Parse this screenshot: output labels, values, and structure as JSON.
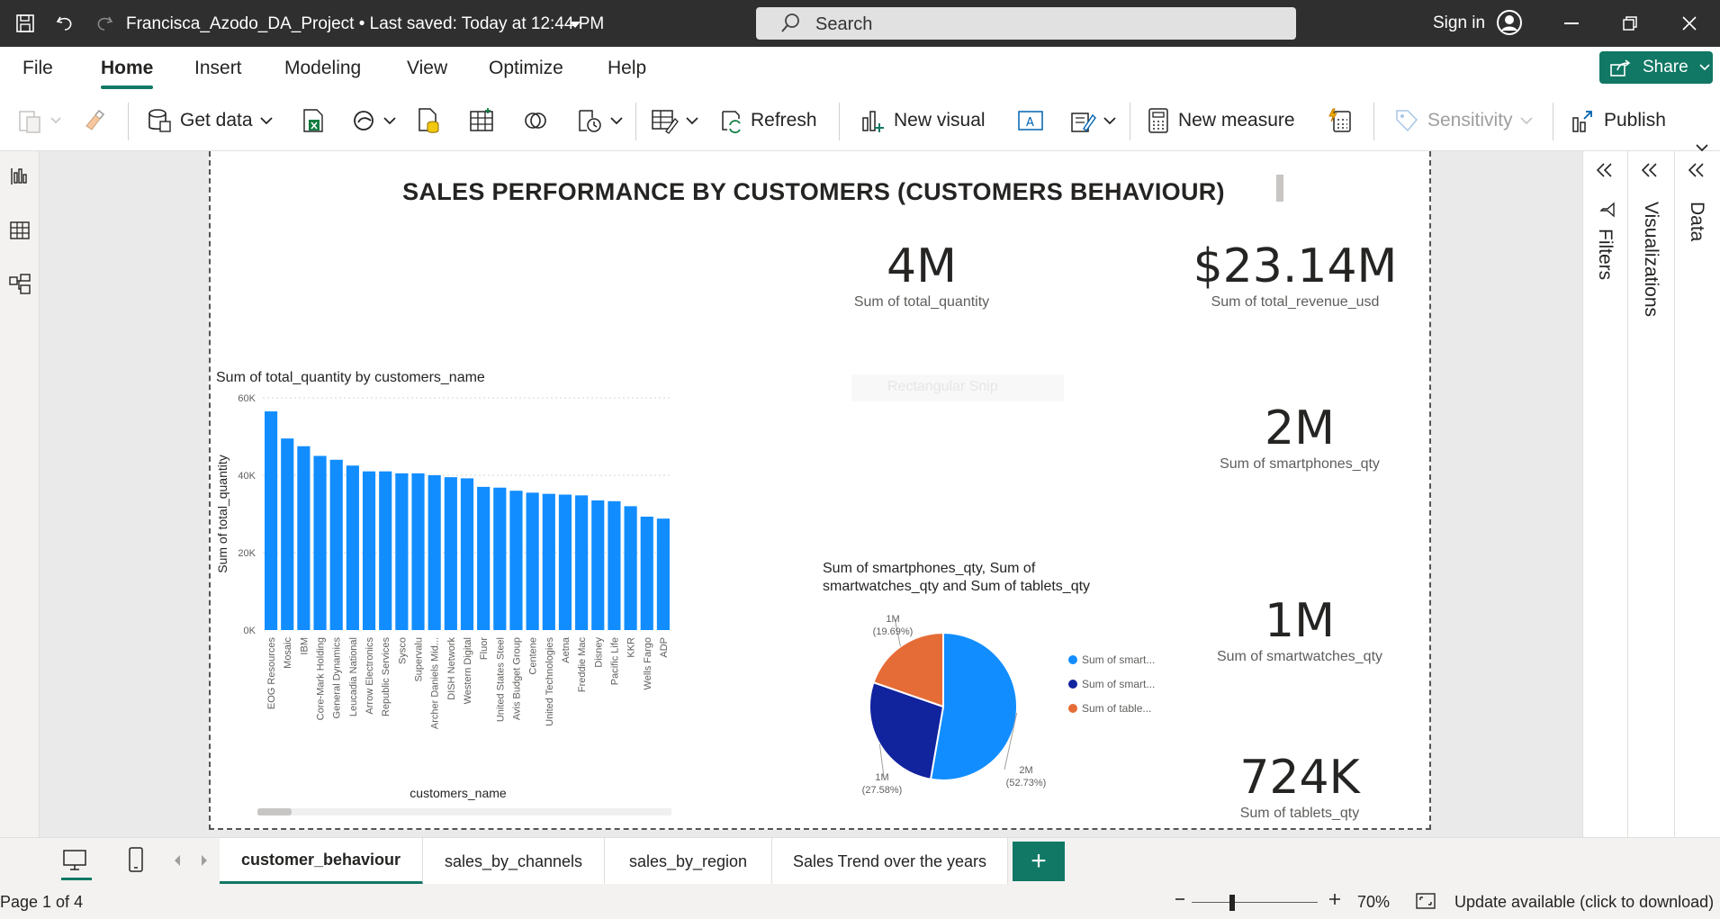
{
  "window": {
    "title": "Francisca_Azodo_DA_Project",
    "saved": " • Last saved: Today at 12:44 PM",
    "search_placeholder": "Search",
    "sign_in": "Sign in"
  },
  "menu": {
    "tabs": [
      "File",
      "Home",
      "Insert",
      "Modeling",
      "View",
      "Optimize",
      "Help"
    ],
    "share": "Share"
  },
  "ribbon": {
    "get_data": "Get data",
    "refresh": "Refresh",
    "new_visual": "New visual",
    "new_measure": "New measure",
    "sensitivity": "Sensitivity",
    "publish": "Publish"
  },
  "report": {
    "title": "SALES PERFORMANCE BY CUSTOMERS (CUSTOMERS BEHAVIOUR)",
    "kpis": [
      {
        "value": "4M",
        "label": "Sum of total_quantity"
      },
      {
        "value": "$23.14M",
        "label": "Sum of total_revenue_usd"
      },
      {
        "value": "2M",
        "label": "Sum of smartphones_qty"
      },
      {
        "value": "1M",
        "label": "Sum of smartwatches_qty"
      },
      {
        "value": "724K",
        "label": "Sum of tablets_qty"
      }
    ],
    "ghost_text": "Rectangular Snip"
  },
  "chart_data": [
    {
      "type": "bar",
      "title": "Sum of total_quantity by customers_name",
      "xlabel": "customers_name",
      "ylabel": "Sum of total_quantity",
      "ylim": [
        0,
        60000
      ],
      "yticks": [
        "0K",
        "20K",
        "40K",
        "60K"
      ],
      "grid": true,
      "color": "#118DFF",
      "categories": [
        "EOG Resources",
        "Mosaic",
        "IBM",
        "Core-Mark Holding",
        "General Dynamics",
        "Leucadia National",
        "Arrow Electronics",
        "Republic Services",
        "Sysco",
        "Supervalu",
        "Archer Daniels Mid...",
        "DISH Network",
        "Western Digital",
        "Fluor",
        "United States Steel",
        "Avis Budget Group",
        "Centene",
        "United Technologies",
        "Aetna",
        "Freddie Mac",
        "Disney",
        "Pacific Life",
        "KKR",
        "Wells Fargo",
        "ADP"
      ],
      "values": [
        56500,
        49500,
        47500,
        45000,
        44000,
        42500,
        41000,
        41000,
        40500,
        40500,
        40000,
        39500,
        39200,
        37000,
        36800,
        36000,
        35500,
        35200,
        35000,
        34800,
        33500,
        33300,
        32000,
        29300,
        28800
      ]
    },
    {
      "type": "pie",
      "title": "Sum of smartphones_qty, Sum of smartwatches_qty and Sum of tablets_qty",
      "legend": "right",
      "series": [
        {
          "name": "Sum of smart...",
          "value": 52.73,
          "label": "2M",
          "pct": "(52.73%)",
          "color": "#118DFF"
        },
        {
          "name": "Sum of smart...",
          "value": 27.58,
          "label": "1M",
          "pct": "(27.58%)",
          "color": "#12239E"
        },
        {
          "name": "Sum of table...",
          "value": 19.69,
          "label": "1M",
          "pct": "(19.69%)",
          "color": "#E66C37"
        }
      ]
    }
  ],
  "panes": {
    "filters": "Filters",
    "visualizations": "Visualizations",
    "data": "Data"
  },
  "pages": {
    "tabs": [
      "customer_behaviour",
      "sales_by_channels",
      "sales_by_region",
      "Sales Trend over the years"
    ],
    "add": "+"
  },
  "status": {
    "page": "Page 1 of 4",
    "zoom": "70%",
    "update": "Update available (click to download)"
  }
}
